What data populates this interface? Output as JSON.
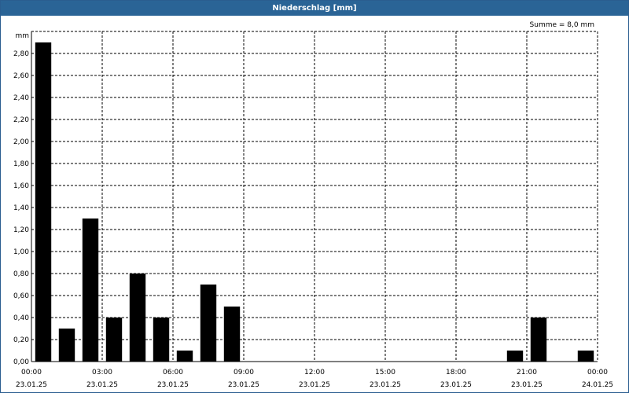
{
  "window": {
    "title": "Niederschlag [mm]"
  },
  "chart_data": {
    "type": "bar",
    "title": "Niederschlag [mm]",
    "ylabel": "mm",
    "annotation": "Summe = 8,0 mm",
    "ylim": [
      0,
      3.0
    ],
    "xlim_hours": [
      0,
      24
    ],
    "y_ticks": [
      "0,00",
      "0,20",
      "0,40",
      "0,60",
      "0,80",
      "1,00",
      "1,20",
      "1,40",
      "1,60",
      "1,80",
      "2,00",
      "2,20",
      "2,40",
      "2,60",
      "2,80"
    ],
    "x_ticks": [
      {
        "time": "00:00",
        "date": "23.01.25",
        "hour": 0
      },
      {
        "time": "03:00",
        "date": "23.01.25",
        "hour": 3
      },
      {
        "time": "06:00",
        "date": "23.01.25",
        "hour": 6
      },
      {
        "time": "09:00",
        "date": "23.01.25",
        "hour": 9
      },
      {
        "time": "12:00",
        "date": "23.01.25",
        "hour": 12
      },
      {
        "time": "15:00",
        "date": "23.01.25",
        "hour": 15
      },
      {
        "time": "18:00",
        "date": "23.01.25",
        "hour": 18
      },
      {
        "time": "21:00",
        "date": "23.01.25",
        "hour": 21
      },
      {
        "time": "00:00",
        "date": "24.01.25",
        "hour": 24
      }
    ],
    "bars": [
      {
        "hour": 0,
        "value": 2.9
      },
      {
        "hour": 1,
        "value": 0.3
      },
      {
        "hour": 2,
        "value": 1.3
      },
      {
        "hour": 3,
        "value": 0.4
      },
      {
        "hour": 4,
        "value": 0.8
      },
      {
        "hour": 5,
        "value": 0.4
      },
      {
        "hour": 6,
        "value": 0.1
      },
      {
        "hour": 7,
        "value": 0.7
      },
      {
        "hour": 8,
        "value": 0.5
      },
      {
        "hour": 20,
        "value": 0.1
      },
      {
        "hour": 21,
        "value": 0.4
      },
      {
        "hour": 23,
        "value": 0.1
      }
    ],
    "grid": true,
    "colors": {
      "bar": "#000000",
      "titlebar": "#2a6496",
      "grid": "#000000"
    }
  }
}
